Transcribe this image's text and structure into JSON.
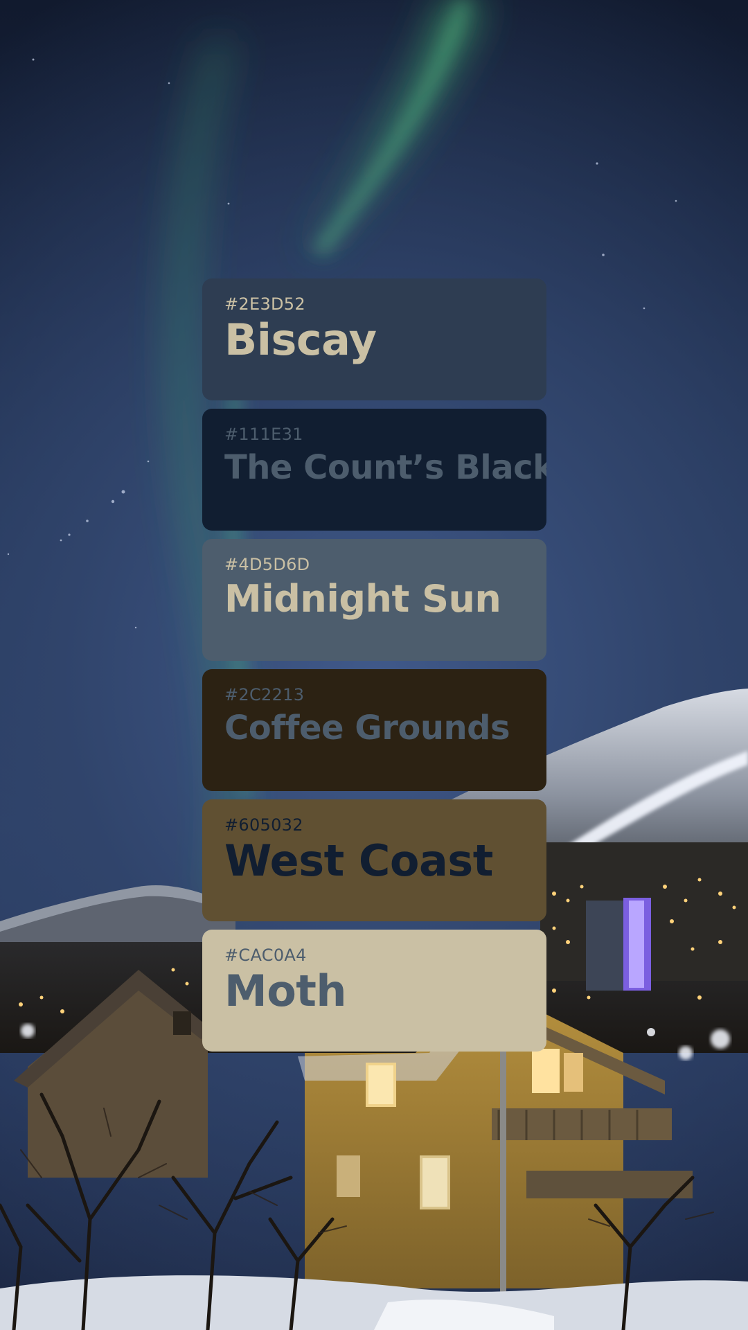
{
  "palette": {
    "swatches": [
      {
        "hex": "#2E3D52",
        "name": "Biscay",
        "text_color": "#cac0a4"
      },
      {
        "hex": "#111E31",
        "name": "The Count’s Black",
        "text_color": "#4d5d6d"
      },
      {
        "hex": "#4D5D6D",
        "name": "Midnight Sun",
        "text_color": "#cac0a4"
      },
      {
        "hex": "#2C2213",
        "name": "Coffee Grounds",
        "text_color": "#4d5d6d"
      },
      {
        "hex": "#605032",
        "name": "West Coast",
        "text_color": "#111e31"
      },
      {
        "hex": "#CAC0A4",
        "name": "Moth",
        "text_color": "#4d5d6d"
      }
    ]
  },
  "colors": {
    "sky_top": "#111a2e",
    "sky_mid": "#2b3e63",
    "aurora": "#3fa06a",
    "house": "#b08a3a"
  },
  "background": {
    "icons": [
      "aurora-sky",
      "mountain",
      "town-lights",
      "wooden-house",
      "bare-trees"
    ]
  }
}
